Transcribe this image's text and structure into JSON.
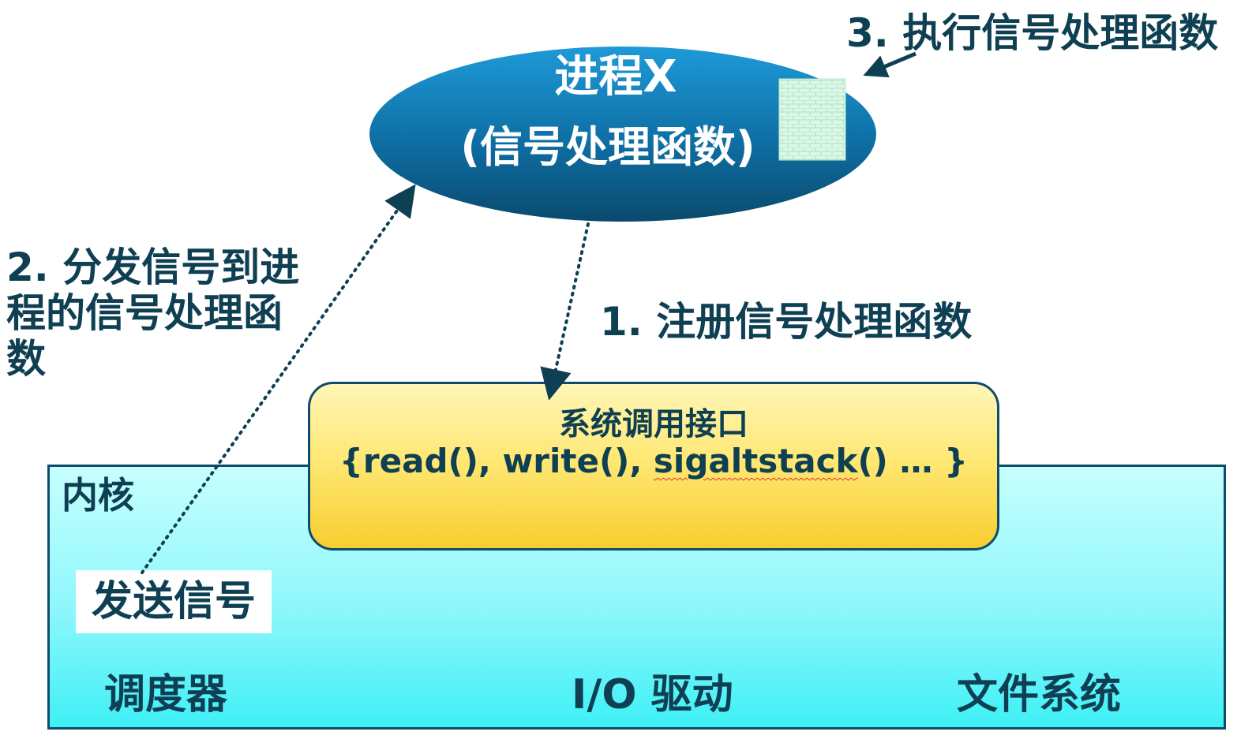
{
  "process": {
    "title": "进程X",
    "subtitle": "(信号处理函数)"
  },
  "steps": {
    "step1": "1. 注册信号处理函数",
    "step2": "2. 分发信号到进程的信号处理函数",
    "step3": "3. 执行信号处理函数"
  },
  "syscall": {
    "title": "系统调用接口",
    "funcs_prefix": "{read(), write(), ",
    "funcs_misspelled": "sigaltstack",
    "funcs_suffix": "() … }"
  },
  "kernel": {
    "label": "内核",
    "send_signal": "发送信号",
    "items": [
      "调度器",
      "I/O 驱动",
      "文件系统"
    ]
  },
  "colors": {
    "ellipse_dark": "#0b4f78",
    "ellipse_light": "#1a95d6",
    "text_dark": "#0e3f52",
    "kernel_fill": "#5ff3f8",
    "syscall_fill": "#fde46a",
    "handler_block": "#c9f2d8"
  }
}
